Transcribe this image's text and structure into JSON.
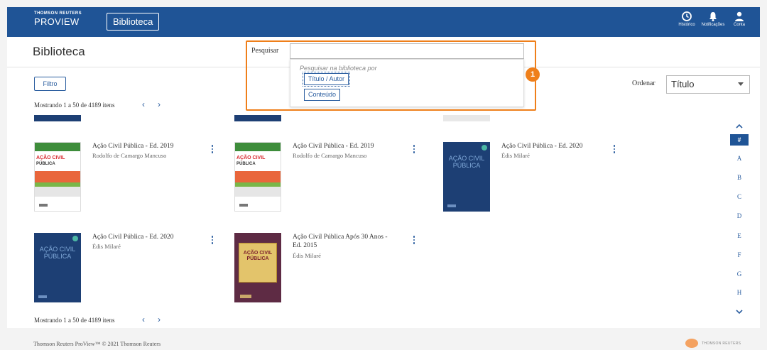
{
  "header": {
    "brand_small": "THOMSON REUTERS",
    "brand_big": "PROVIEW",
    "library_tab": "Biblioteca",
    "icons": [
      {
        "name": "history-icon",
        "label": "Histórico"
      },
      {
        "name": "bell-icon",
        "label": "Notificações"
      },
      {
        "name": "user-icon",
        "label": "Conta"
      }
    ]
  },
  "page": {
    "title": "Biblioteca"
  },
  "search": {
    "label": "Pesquisar",
    "value": "",
    "hint": "Pesquisar na biblioteca por",
    "options": [
      "Título / Autor",
      "Conteúdo"
    ]
  },
  "annotation": {
    "callout": "1",
    "color": "#ef7f1a"
  },
  "toolbar": {
    "filter_label": "Filtro",
    "showing_text": "Mostrando 1 a 50 de 4189 itens",
    "prev_icon": "‹",
    "next_icon": "›",
    "order_label": "Ordenar",
    "order_value": "Título"
  },
  "books": [
    {
      "title": "Ação Civil Pública - Ed. 2019",
      "author": "Rodolfo de Camargo Mancuso",
      "cover": "green",
      "cover_title_1": "AÇÃO CIVIL",
      "cover_title_2": "PÚBLICA"
    },
    {
      "title": "Ação Civil Pública - Ed. 2019",
      "author": "Rodolfo de Camargo Mancuso",
      "cover": "green",
      "cover_title_1": "AÇÃO CIVIL",
      "cover_title_2": "PÚBLICA"
    },
    {
      "title": "Ação Civil Pública - Ed. 2020",
      "author": "Édis Milaré",
      "cover": "blue",
      "cover_title": "AÇÃO CIVIL PÚBLICA"
    },
    {
      "title": "Ação Civil Pública - Ed. 2020",
      "author": "Édis Milaré",
      "cover": "blue",
      "cover_title": "AÇÃO CIVIL PÚBLICA"
    },
    {
      "title": "Ação Civil Pública Após 30 Anos - Ed. 2015",
      "author": "Édis Milaré",
      "cover": "brown",
      "cover_title": "AÇÃO CIVIL PÚBLICA"
    }
  ],
  "alphabet": [
    "#",
    "A",
    "B",
    "C",
    "D",
    "E",
    "F",
    "G",
    "H"
  ],
  "alphabet_active": "#",
  "footer": {
    "copyright": "Thomson Reuters ProView™ © 2021 Thomson Reuters",
    "logo_text": "THOMSON REUTERS"
  },
  "colors": {
    "header_bg": "#1f5496",
    "accent": "#2a5d9f",
    "highlight": "#ef7f1a"
  }
}
